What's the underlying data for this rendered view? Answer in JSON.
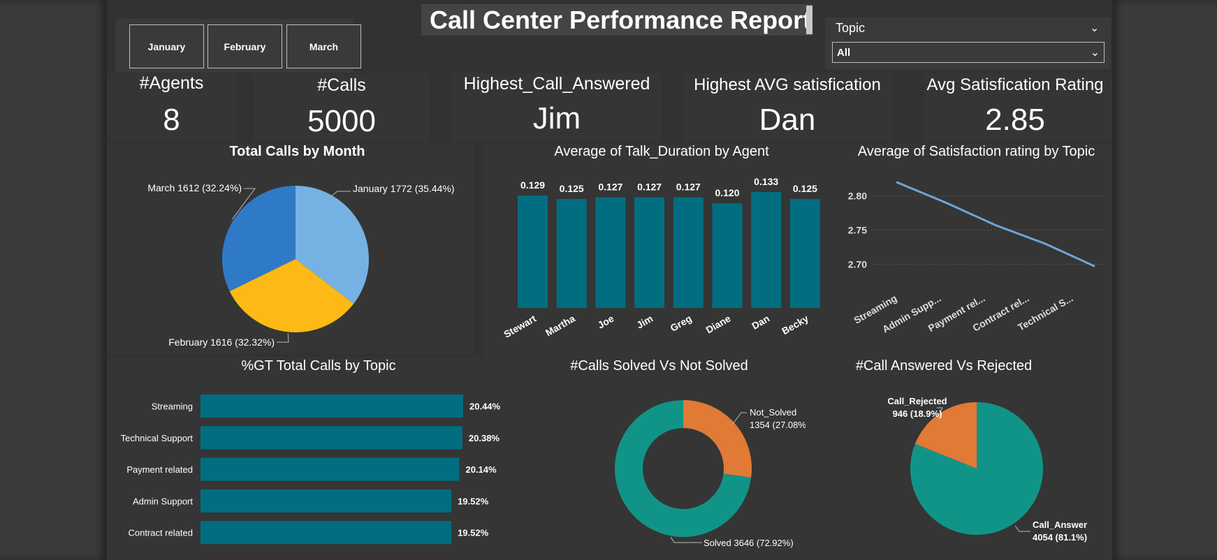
{
  "title": "Call Center Performance Report",
  "months": [
    "January",
    "February",
    "March"
  ],
  "slicer": {
    "label": "Topic",
    "value": "All"
  },
  "kpis": {
    "agents": {
      "label": "#Agents",
      "value": "8"
    },
    "calls": {
      "label": "#Calls",
      "value": "5000"
    },
    "highest_answered": {
      "label": "Highest_Call_Answered",
      "value": "Jim"
    },
    "highest_satisfaction": {
      "label": "Highest AVG satisfication",
      "value": "Dan"
    },
    "avg_rating": {
      "label": "Avg Satisfication Rating",
      "value": "2.85"
    }
  },
  "colors": {
    "teal": "#006e80",
    "bar_teal": "#0b6b7e",
    "green": "#119488",
    "orange": "#e07a35",
    "blue_dark": "#2f7ac6",
    "blue_light": "#75b2e3",
    "yellow": "#fdb915",
    "line": "#6ca6d9"
  },
  "chart_data": [
    {
      "type": "pie",
      "title": "Total Calls by Month",
      "categories": [
        "January",
        "February",
        "March"
      ],
      "values": [
        1772,
        1616,
        1612
      ],
      "labels": [
        "January 1772 (35.44%)",
        "February 1616 (32.32%)",
        "March 1612 (32.24%)"
      ]
    },
    {
      "type": "bar",
      "title": "Average of Talk_Duration by Agent",
      "categories": [
        "Stewart",
        "Martha",
        "Joe",
        "Jim",
        "Greg",
        "Diane",
        "Dan",
        "Becky"
      ],
      "values": [
        0.129,
        0.125,
        0.127,
        0.127,
        0.127,
        0.12,
        0.133,
        0.125
      ],
      "value_labels": [
        "0.129",
        "0.125",
        "0.127",
        "0.127",
        "0.127",
        "0.120",
        "0.133",
        "0.125"
      ]
    },
    {
      "type": "line",
      "title": "Average of Satisfaction rating by Topic",
      "categories": [
        "Streaming",
        "Admin Supp...",
        "Payment rel...",
        "Contract rel...",
        "Technical S..."
      ],
      "values": [
        2.82,
        2.79,
        2.757,
        2.73,
        2.697
      ],
      "yticks": [
        "2.80",
        "2.75",
        "2.70"
      ],
      "ylim": [
        2.68,
        2.83
      ]
    },
    {
      "type": "bar",
      "orientation": "horizontal",
      "title": "%GT Total Calls by Topic",
      "categories": [
        "Streaming",
        "Technical Support",
        "Payment related",
        "Admin Support",
        "Contract related"
      ],
      "values": [
        20.44,
        20.38,
        20.14,
        19.52,
        19.52
      ],
      "value_labels": [
        "20.44%",
        "20.38%",
        "20.14%",
        "19.52%",
        "19.52%"
      ]
    },
    {
      "type": "pie",
      "subtype": "donut",
      "title": "#Calls Solved Vs Not Solved",
      "categories": [
        "Not_Solved",
        "Solved"
      ],
      "values": [
        1354,
        3646
      ],
      "labels": [
        [
          "Not_Solved",
          "1354 (27.08%)"
        ],
        [
          "Solved 3646 (72.92%)"
        ]
      ]
    },
    {
      "type": "pie",
      "title": "#Call Answered Vs Rejected",
      "categories": [
        "Call_Rejected",
        "Call_Answer"
      ],
      "values": [
        946,
        4054
      ],
      "labels": [
        [
          "Call_Rejected",
          "946 (18.9%)"
        ],
        [
          "Call_Answer",
          "4054 (81.1%)"
        ]
      ]
    }
  ]
}
